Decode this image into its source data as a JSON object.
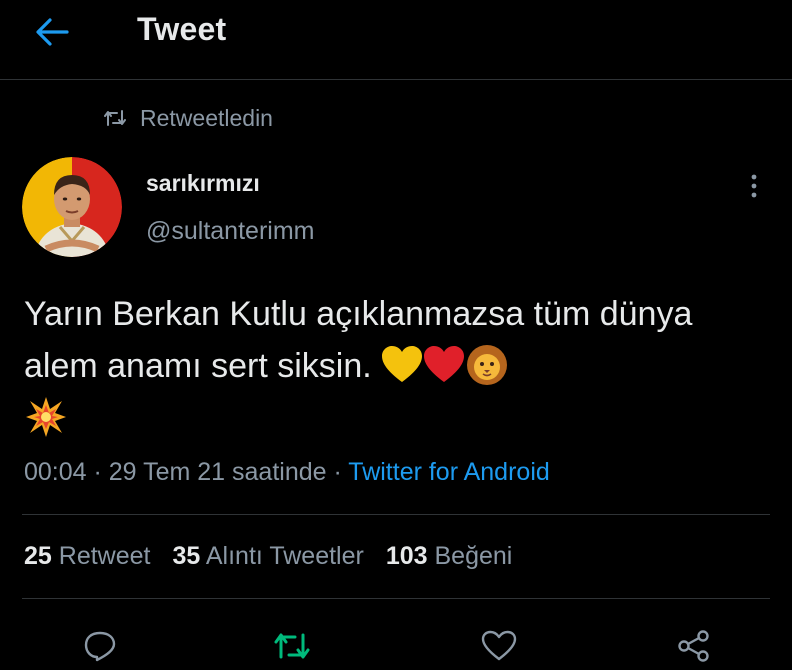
{
  "header": {
    "title": "Tweet"
  },
  "social_context": {
    "label": "Retweetledin"
  },
  "author": {
    "display_name": "sarıkırmızı",
    "handle": "@sultanterimm"
  },
  "tweet": {
    "text": "Yarın Berkan Kutlu açıklanmazsa tüm dünya alem anamı sert siksin.",
    "emojis": [
      "yellow-heart",
      "red-heart",
      "lion-face",
      "collision"
    ]
  },
  "meta": {
    "time": "00:04",
    "separator1": " · ",
    "date": "29 Tem 21 saatinde",
    "separator2": " · ",
    "source": "Twitter for Android"
  },
  "stats": {
    "retweets_count": "25",
    "retweets_label": "Retweet",
    "quotes_count": "35",
    "quotes_label": "Alıntı Tweetler",
    "likes_count": "103",
    "likes_label": "Beğeni"
  },
  "actions": {
    "reply_icon": "reply-icon",
    "retweet_icon": "retweet-icon",
    "like_icon": "like-icon",
    "share_icon": "share-icon",
    "retweeted": true
  },
  "colors": {
    "background": "#000000",
    "accent": "#1d9bf0",
    "retweet_green": "#00ba7c",
    "muted": "#8b98a5",
    "text": "#e7e9ea",
    "divider": "#2f3336"
  }
}
